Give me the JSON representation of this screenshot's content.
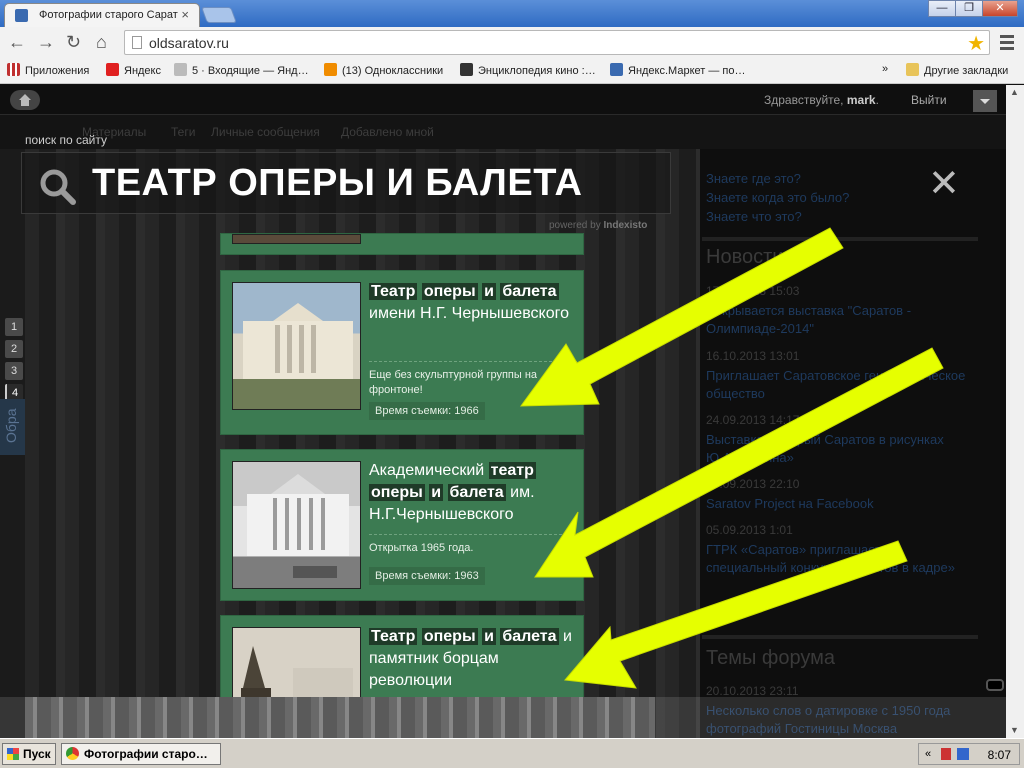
{
  "browser": {
    "tab_title": "Фотографии старого Сарат",
    "tab_close": "×",
    "url": "oldsaratov.ru",
    "window_controls": [
      "minimize-icon",
      "restore-icon",
      "close-icon"
    ],
    "bookmarks": [
      {
        "label": "Приложения",
        "icon": "apps-grid-icon",
        "color": "#c03030"
      },
      {
        "label": "Яндекс",
        "icon": "yandex-icon",
        "color": "#e02020"
      },
      {
        "label": "5 · Входящие — Янд…",
        "icon": "mail-icon",
        "color": "#888888"
      },
      {
        "label": "(13) Одноклассники",
        "icon": "ok-icon",
        "color": "#f08c00"
      },
      {
        "label": "Энциклопедия кино :…",
        "icon": "film-icon",
        "color": "#333333"
      },
      {
        "label": "Яндекс.Маркет — по…",
        "icon": "market-icon",
        "color": "#3a6ab0"
      }
    ],
    "bookmarks_more": "»",
    "other_bookmarks": "Другие закладки"
  },
  "site": {
    "greeting_prefix": "Здравствуйте,",
    "username": "mark",
    "greeting_suffix": ".",
    "logout": "Выйти",
    "nav": [
      "Материалы",
      "Теги",
      "Личные сообщения",
      "Добавлено мной"
    ],
    "search_label": "поиск по сайту",
    "search_query": "ТЕАТР ОПЕРЫ И БАЛЕТА",
    "powered_by": "powered by",
    "powered_brand": "Indexisto",
    "close_symbol": "✕",
    "pager": [
      "1",
      "2",
      "3",
      "4"
    ],
    "side_tab": "Обра",
    "right_links": [
      "Знаете где это?",
      "Знаете когда это было?",
      "Знаете что это?"
    ],
    "news_heading": "Новости",
    "news": [
      {
        "date": "17.10.2013 15:03",
        "title": "Открывается выставка \"Саратов - Олимпиаде-2014\""
      },
      {
        "date": "16.10.2013 13:01",
        "title": "Приглашает Саратовское генеалогическое общество"
      },
      {
        "date": "24.09.2013 14:17",
        "title": "Выставка «Старый Саратов в рисунках Ю.Архипкина»"
      },
      {
        "date": "10.09.2013 22:10",
        "title": "Saratov Project на Facebook"
      },
      {
        "date": "05.09.2013 1:01",
        "title": "ГТРК «Саратов» приглашает на специальный конкурс «Саратов в кадре»"
      }
    ],
    "forum_heading": "Темы форума",
    "forum": [
      {
        "date": "20.10.2013 23:11",
        "title": "Несколько слов о датировке с 1950 года фотографий Гостиницы Москва"
      }
    ]
  },
  "results": [
    {
      "title_parts": [
        {
          "text": "Театр",
          "hl": true
        },
        {
          "text": " ",
          "hl": false
        },
        {
          "text": "оперы",
          "hl": true
        },
        {
          "text": " ",
          "hl": false
        },
        {
          "text": "и",
          "hl": true
        },
        {
          "text": " ",
          "hl": false
        },
        {
          "text": "балета",
          "hl": true
        },
        {
          "text": " имени Н.Г. Чернышевского",
          "hl": false
        }
      ],
      "description": "Еще без скульптурной группы на фронтоне!",
      "year": "Время съемки: 1966"
    },
    {
      "title_parts": [
        {
          "text": "Академический ",
          "hl": false
        },
        {
          "text": "театр",
          "hl": true
        },
        {
          "text": " ",
          "hl": false
        },
        {
          "text": "оперы",
          "hl": true
        },
        {
          "text": " ",
          "hl": false
        },
        {
          "text": "и",
          "hl": true
        },
        {
          "text": " ",
          "hl": false
        },
        {
          "text": "балета",
          "hl": true
        },
        {
          "text": " им. Н.Г.Чернышевского",
          "hl": false
        }
      ],
      "description": "Открытка 1965 года.",
      "year": "Время съемки: 1963"
    },
    {
      "title_parts": [
        {
          "text": "Театр",
          "hl": true
        },
        {
          "text": " ",
          "hl": false
        },
        {
          "text": "оперы",
          "hl": true
        },
        {
          "text": " ",
          "hl": false
        },
        {
          "text": "и",
          "hl": true
        },
        {
          "text": " ",
          "hl": false
        },
        {
          "text": "балета",
          "hl": true
        },
        {
          "text": " и памятник борцам революции",
          "hl": false
        }
      ],
      "description": "",
      "year": ""
    }
  ],
  "colors": {
    "card_bg": "#3c7b52",
    "highlight_bg": "#1f3b28",
    "arrow": "#e6ff00"
  },
  "taskbar": {
    "start": "Пуск",
    "task": "Фотографии старо…",
    "clock": "8:07",
    "tray_collapse": "«"
  }
}
